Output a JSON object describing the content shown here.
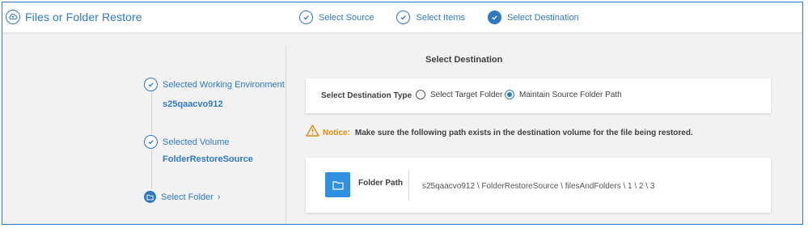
{
  "app": {
    "title": "Files or Folder Restore",
    "accent_color": "#2f78c4",
    "icon": "cloud-restore-icon"
  },
  "wizard_steps": [
    {
      "label": "Select Source",
      "state": "completed"
    },
    {
      "label": "Select Items",
      "state": "completed"
    },
    {
      "label": "Select Destination",
      "state": "active"
    }
  ],
  "summary": {
    "working_environment": {
      "label": "Selected Working Environment",
      "value": "s25qaacvo912"
    },
    "volume": {
      "label": "Selected Volume",
      "value": "FolderRestoreSource"
    },
    "folder": {
      "label": "Select Folder"
    }
  },
  "destination": {
    "section_title": "Select Destination",
    "type_label": "Select Destination Type",
    "options": [
      {
        "label": "Select Target Folder",
        "selected": false
      },
      {
        "label": "Maintain Source Folder Path",
        "selected": true
      }
    ],
    "notice_label": "Notice:",
    "notice_text": "Make sure the following path exists in the destination volume for the file being restored.",
    "notice_color": "#e58b0d",
    "folder_path_label": "Folder Path",
    "folder_path_value": "s25qaacvo912 \\ FolderRestoreSource \\ filesAndFolders \\ 1 \\ 2 \\ 3"
  }
}
